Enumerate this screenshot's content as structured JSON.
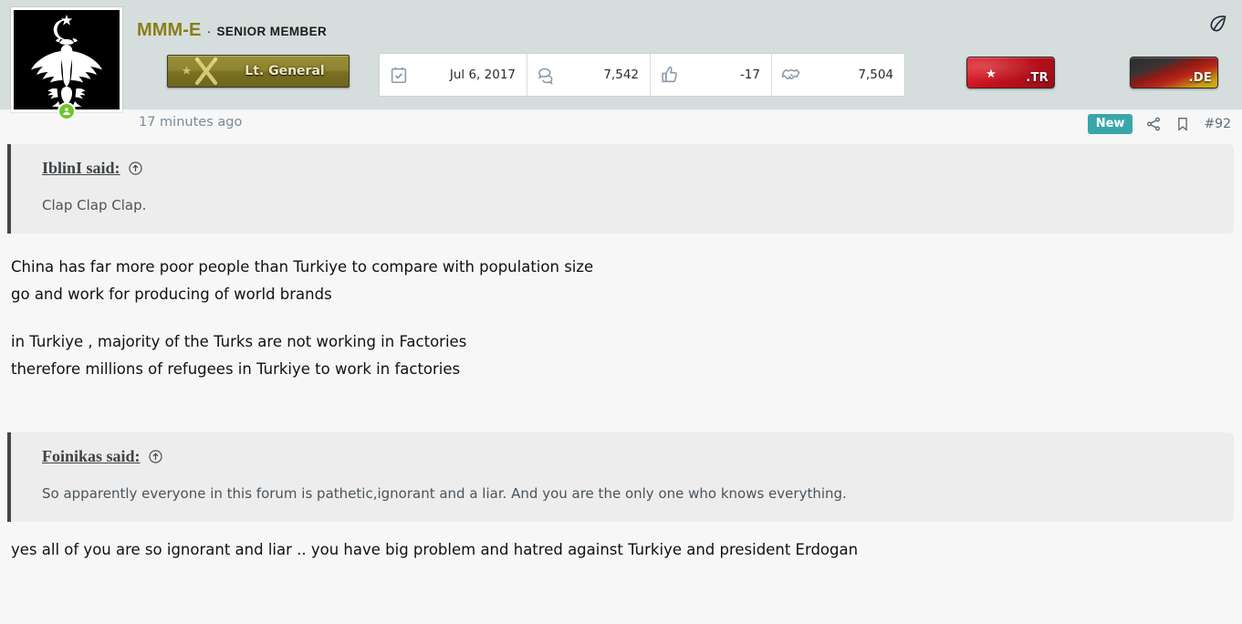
{
  "post": {
    "author": {
      "username": "MMM-E",
      "separator": "·",
      "title": "Senior Member",
      "avatar_alt": "black-double-headed-eagle-crescent-star",
      "online": true
    },
    "rank": {
      "label": "Lt. General",
      "insignia": "crescent-star-and-crossed-swords"
    },
    "stats": [
      {
        "icon": "calendar-check-icon",
        "name": "joined",
        "value": "Jul 6, 2017"
      },
      {
        "icon": "messages-icon",
        "name": "messages",
        "value": "7,542"
      },
      {
        "icon": "thumbs-up-icon",
        "name": "reaction-score",
        "value": "-17"
      },
      {
        "icon": "handshake-icon",
        "name": "points",
        "value": "7,504"
      }
    ],
    "flags": [
      {
        "name": "flag-turkey",
        "label": ".TR"
      },
      {
        "name": "flag-germany",
        "label": ".DE"
      }
    ],
    "meta": {
      "timestamp": "17 minutes ago",
      "new_badge": "New",
      "share_icon": "share-icon",
      "bookmark_icon": "bookmark-icon",
      "post_number": "#92"
    },
    "leaf_icon": "leaf-icon",
    "quotes": [
      {
        "attribution": "IblinI said:",
        "jump_icon": "arrow-up-circle-icon",
        "text": "Clap Clap Clap."
      },
      {
        "attribution": "Foinikas said:",
        "jump_icon": "arrow-up-circle-icon",
        "text": "So apparently everyone in this forum is pathetic,ignorant and a liar. And you are the only one who knows everything."
      }
    ],
    "body_blocks": [
      "China has far more poor people than Turkiye to compare with population size\ngo and work for producing of world brands",
      "in Turkiye , majority of the Turks are not working in Factories\ntherefore millions of refugees in Turkiye to work in factories",
      "yes all of you are so ignorant and liar .. you have big problem and hatred against Turkiye and president Erdogan"
    ]
  },
  "colors": {
    "header_bg": "#d6dedd",
    "page_bg": "#f7f7f7",
    "username": "#8a7d19",
    "badge_new": "#3aa6a8",
    "quote_bg": "#ededed",
    "quote_border": "#41474a",
    "online_dot": "#6ec72d",
    "rank_banner": "#8e8431"
  }
}
